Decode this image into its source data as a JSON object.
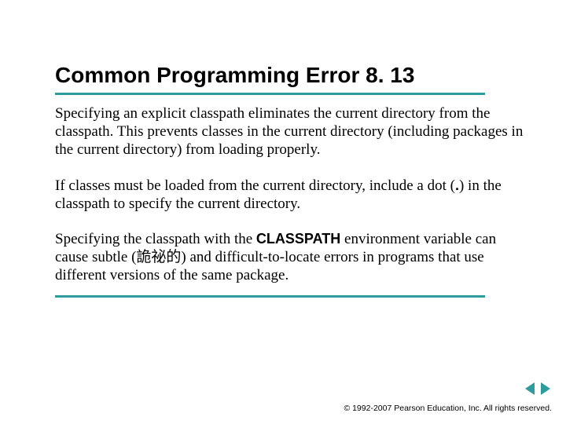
{
  "title": "Common Programming Error 8. 13",
  "paragraphs": {
    "p1": "Specifying an explicit classpath eliminates the current directory from the classpath. This prevents classes in the current directory (including packages in the current directory) from loading properly.",
    "p2_pre": "If classes must be loaded from the current directory, include a dot (",
    "p2_dot": ".",
    "p2_post": ") in the classpath to specify the current directory.",
    "p3_pre": "Specifying the classpath with the ",
    "p3_code": "CLASSPATH",
    "p3_post": " environment variable can cause subtle (詭祕的) and difficult-to-locate errors in programs that use different versions of the same package."
  },
  "footer": {
    "copyright": "© 1992-2007 Pearson Education, Inc.  All rights reserved."
  }
}
